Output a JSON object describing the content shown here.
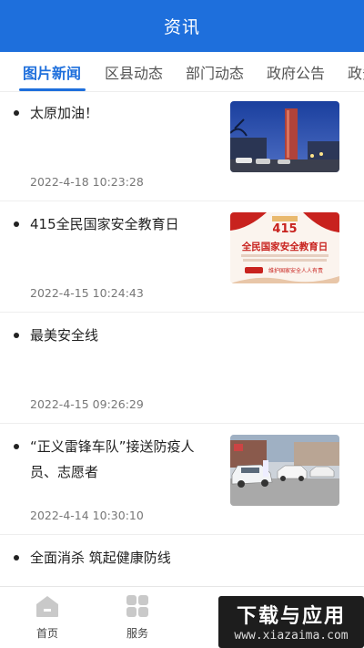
{
  "header": {
    "title": "资讯"
  },
  "tabs": [
    {
      "label": "图片新闻",
      "active": true
    },
    {
      "label": "区县动态",
      "active": false
    },
    {
      "label": "部门动态",
      "active": false
    },
    {
      "label": "政府公告",
      "active": false
    },
    {
      "label": "政务",
      "active": false
    }
  ],
  "news": [
    {
      "title": "太原加油！",
      "date": "2022-4-18 10:23:28",
      "thumbnail": "night-tower-photo"
    },
    {
      "title": "415全民国家安全教育日",
      "date": "2022-4-15 10:24:43",
      "thumbnail": "security-day-poster",
      "poster_text": {
        "big": "415",
        "headline": "全民国家安全教育日",
        "slogan": "维护国家安全人人有责"
      }
    },
    {
      "title": "最美安全线",
      "date": "2022-4-15 09:26:29",
      "thumbnail": null
    },
    {
      "title_line1": "“正义雷锋车队”接送防疫人",
      "title_line2": "员、志愿者",
      "date": "2022-4-14 10:30:10",
      "thumbnail": "cars-street-photo"
    },
    {
      "title": "全面消杀 筑起健康防线",
      "date": "",
      "thumbnail": null
    }
  ],
  "bottom_nav": [
    {
      "label": "首页",
      "icon": "home-icon"
    },
    {
      "label": "服务",
      "icon": "grid-icon"
    }
  ],
  "watermark": {
    "title": "下载与应用",
    "url": "www.xiazaima.com"
  },
  "colors": {
    "primary": "#1E6FDC",
    "text": "#222222",
    "muted": "#777777"
  }
}
